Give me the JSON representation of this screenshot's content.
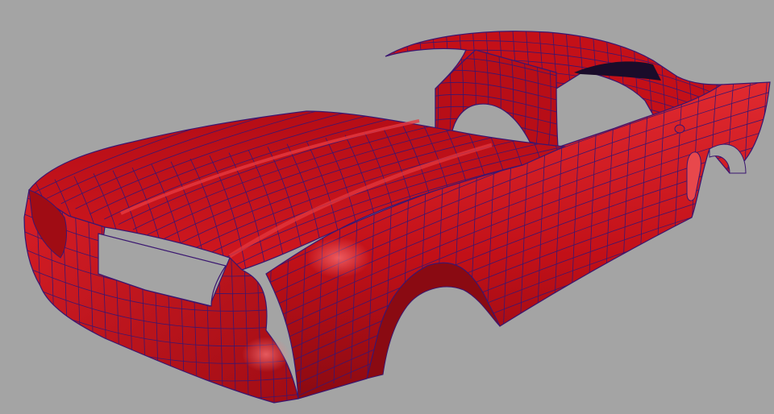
{
  "viewport": {
    "background_color": "#a4a4a4",
    "model": {
      "name": "car-body-mesh",
      "surface_color": "#c8101a",
      "highlight_color": "#e23a3e",
      "shadow_color": "#7a0a10",
      "wire_color": "#3a1670",
      "parts": [
        "hood",
        "front-fender-left",
        "front-grille-opening",
        "front-bumper",
        "headlight-bucket",
        "front-wheel-arch",
        "body-side-panel",
        "door-panel",
        "roof",
        "c-pillar",
        "rear-quarter-panel",
        "rear-wheel-arch",
        "side-scoop"
      ]
    }
  }
}
